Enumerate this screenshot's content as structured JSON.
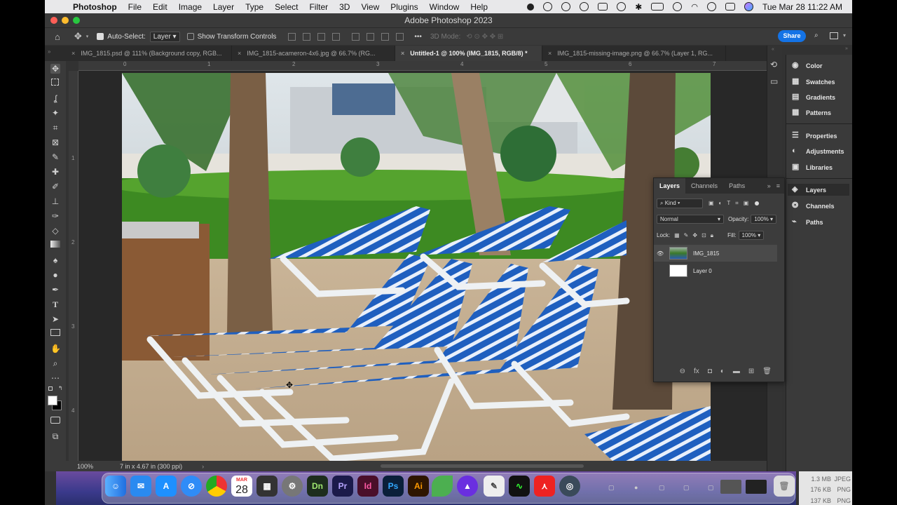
{
  "menubar": {
    "app": "Photoshop",
    "items": [
      "File",
      "Edit",
      "Image",
      "Layer",
      "Type",
      "Select",
      "Filter",
      "3D",
      "View",
      "Plugins",
      "Window",
      "Help"
    ],
    "clock": "Tue Mar 28  11:22 AM"
  },
  "window": {
    "title": "Adobe Photoshop 2023"
  },
  "options": {
    "auto_select_label": "Auto-Select:",
    "auto_select_value": "Layer",
    "show_transform_label": "Show Transform Controls",
    "mode_3d_label": "3D Mode:",
    "share_label": "Share"
  },
  "tabs": [
    {
      "label": "IMG_1815.psd @ 111% (Background copy, RGB...",
      "active": false
    },
    {
      "label": "IMG_1815-acameron-4x6.jpg @ 66.7% (RG...",
      "active": false
    },
    {
      "label": "Untitled-1 @ 100% (IMG_1815, RGB/8) *",
      "active": true
    },
    {
      "label": "IMG_1815-missing-image.png @ 66.7% (Layer 1, RG...",
      "active": false
    }
  ],
  "rulers": {
    "top": [
      "0",
      "1",
      "2",
      "3",
      "4",
      "5",
      "6",
      "7"
    ],
    "left": [
      "1",
      "2",
      "3",
      "4"
    ]
  },
  "status": {
    "zoom": "100%",
    "doc_size": "7 in x 4.67 in (300 ppi)"
  },
  "right_panels": {
    "group1": [
      "Color",
      "Swatches",
      "Gradients",
      "Patterns"
    ],
    "group2": [
      "Properties",
      "Adjustments",
      "Libraries"
    ],
    "group3": [
      "Layers",
      "Channels",
      "Paths"
    ]
  },
  "layers_panel": {
    "tabs": [
      "Layers",
      "Channels",
      "Paths"
    ],
    "filter_kind": "Kind",
    "blend_mode": "Normal",
    "opacity_label": "Opacity:",
    "opacity_value": "100%",
    "lock_label": "Lock:",
    "fill_label": "Fill:",
    "fill_value": "100%",
    "layers": [
      {
        "name": "IMG_1815",
        "visible": true,
        "selected": true
      },
      {
        "name": "Layer 0",
        "visible": false,
        "selected": false
      }
    ]
  },
  "dock": {
    "calendar_month": "MAR",
    "calendar_day": "28",
    "apps": [
      "Finder",
      "Mail",
      "App Store",
      "Safari",
      "Chrome",
      "Calendar",
      "Calculator",
      "Settings",
      "Dn",
      "Pr",
      "Id",
      "Ps",
      "Ai",
      "Leaf",
      "Arrow",
      "TextEdit",
      "Activity Monitor",
      "Acrobat",
      "Camera",
      "Trash"
    ]
  },
  "finder_info": {
    "rows": [
      {
        "size": "1.3 MB",
        "kind": "JPEG"
      },
      {
        "size": "176 KB",
        "kind": "PNG"
      },
      {
        "size": "137 KB",
        "kind": "PNG"
      }
    ]
  }
}
